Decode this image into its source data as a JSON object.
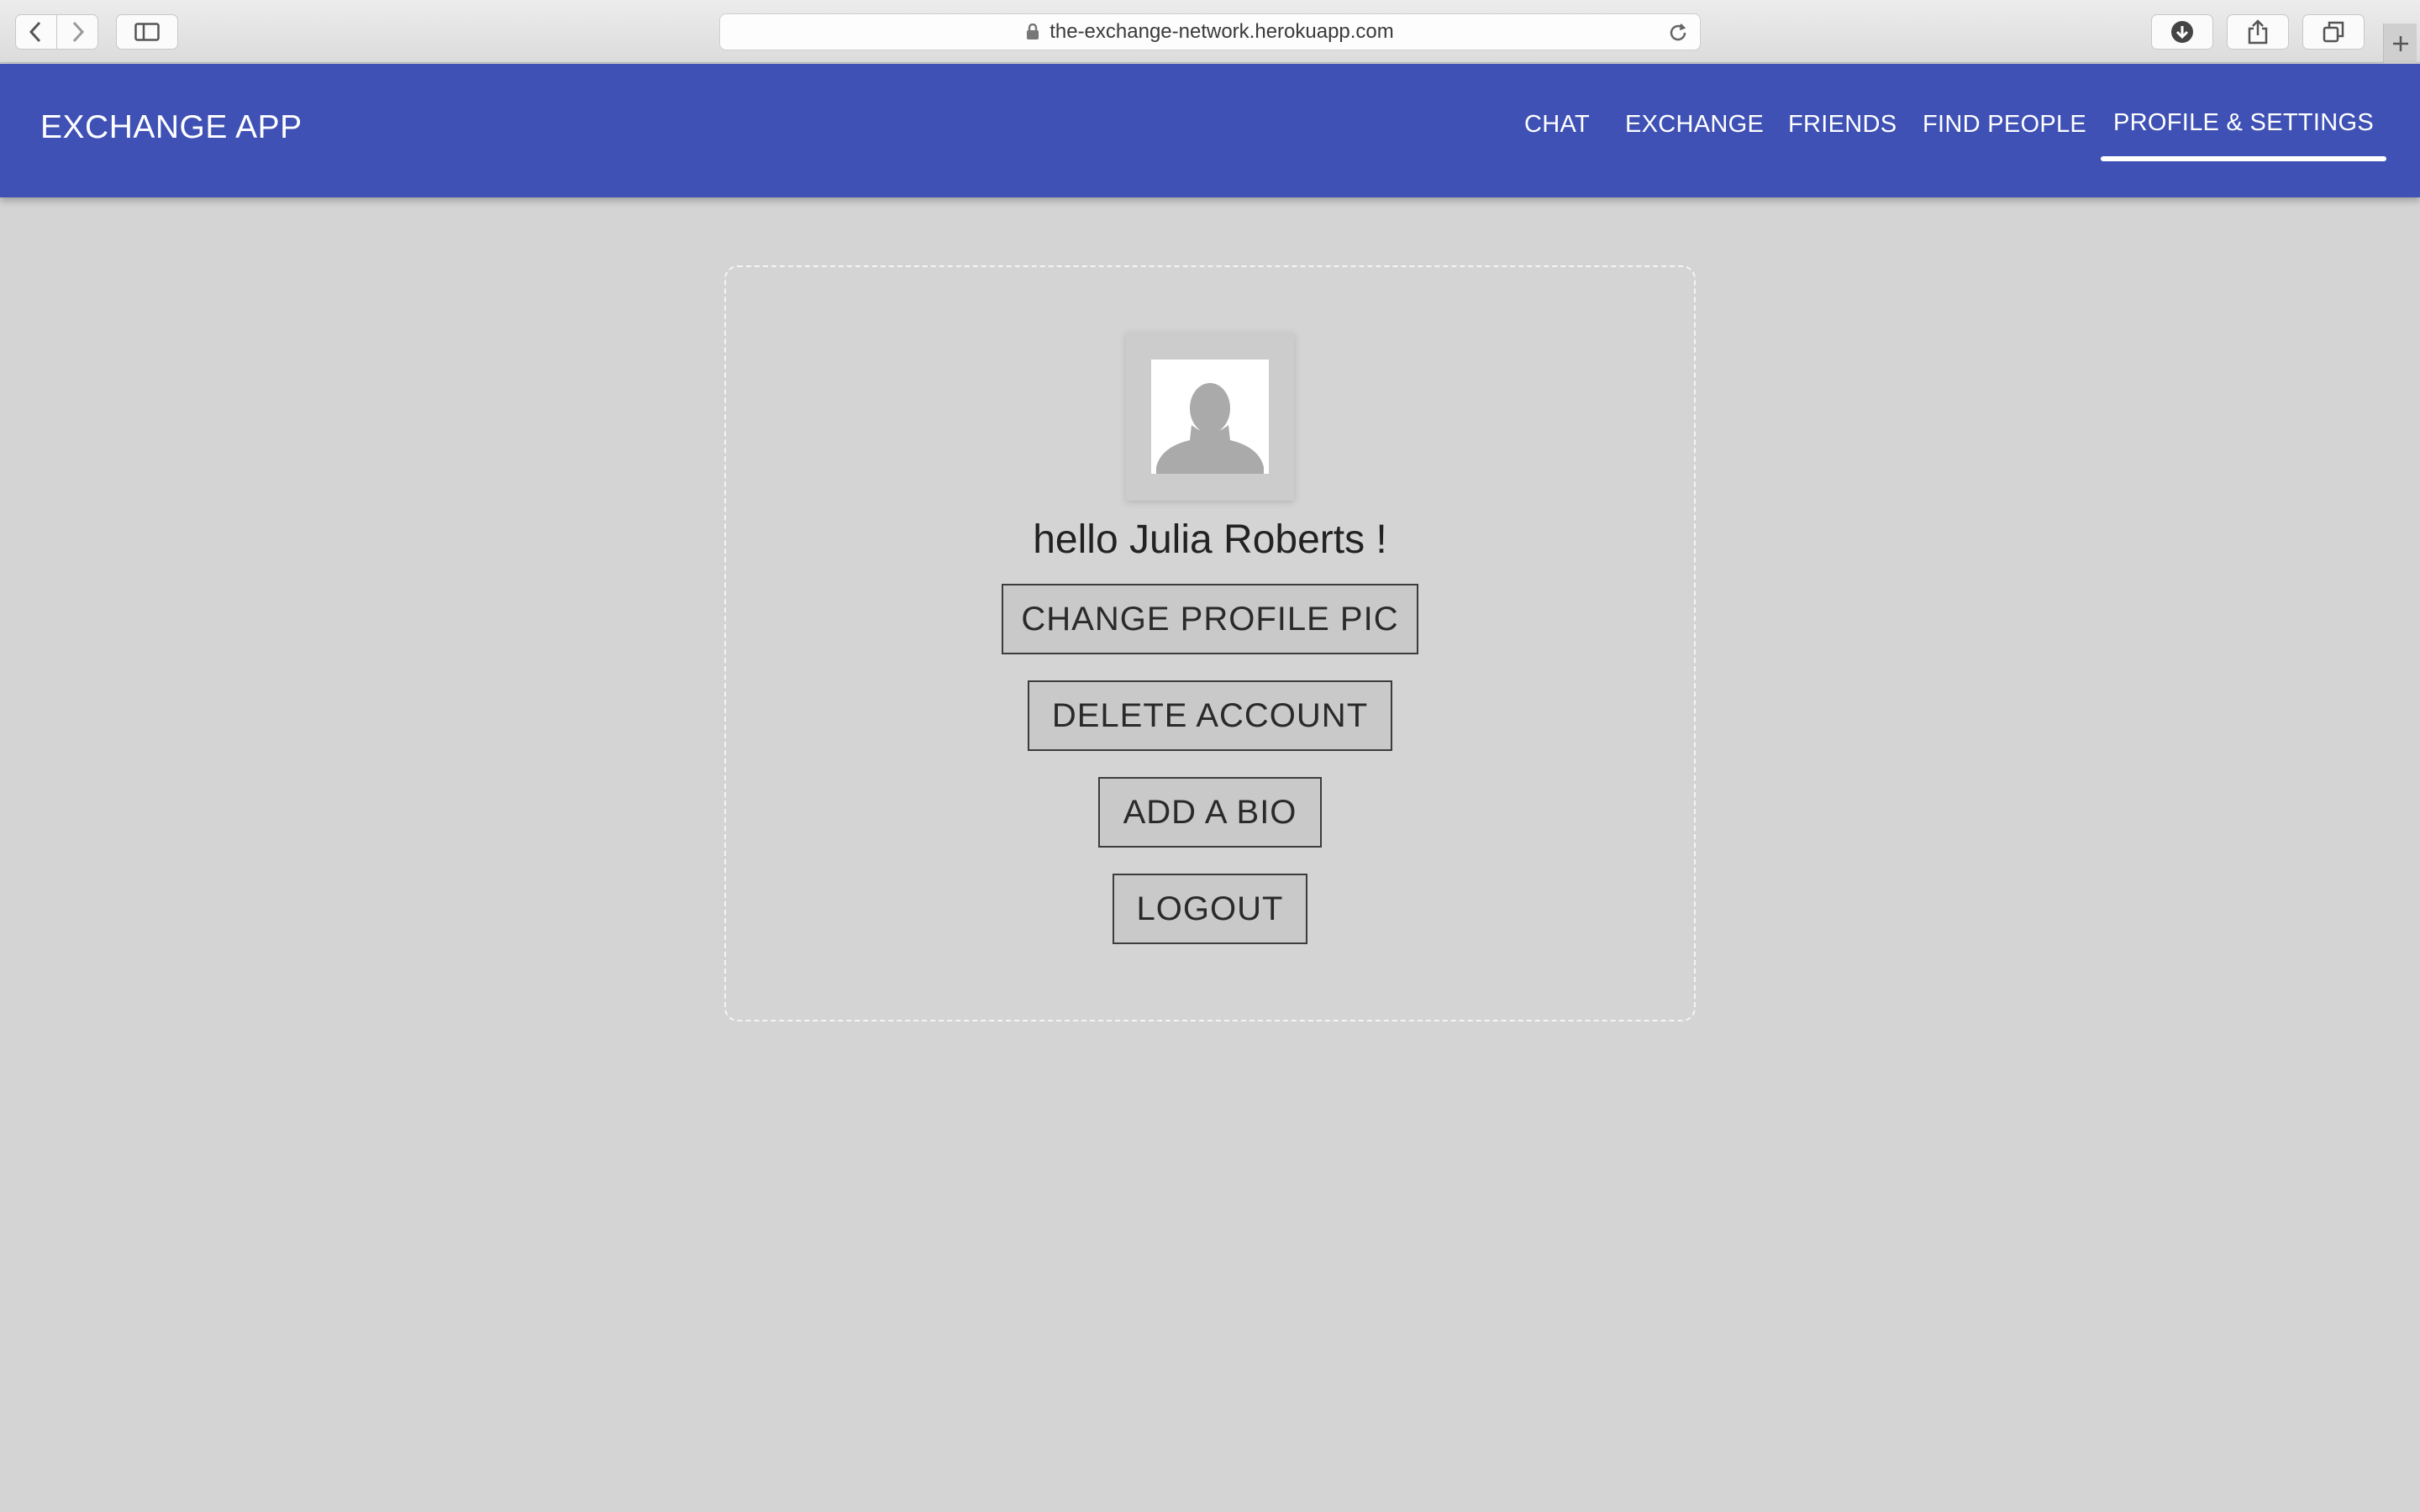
{
  "browser": {
    "url": "the-exchange-network.herokuapp.com"
  },
  "header": {
    "title": "EXCHANGE APP",
    "nav": [
      {
        "label": "CHAT"
      },
      {
        "label": "EXCHANGE"
      },
      {
        "label": "FRIENDS"
      },
      {
        "label": "FIND PEOPLE"
      },
      {
        "label": "PROFILE & SETTINGS",
        "active": true
      }
    ],
    "bg_color": "#3f51b5"
  },
  "profile": {
    "greeting": "hello Julia Roberts !",
    "avatar_icon": "default-user-silhouette",
    "buttons": {
      "change_pic": "CHANGE PROFILE PIC",
      "delete_account": "DELETE ACCOUNT",
      "add_bio": "ADD A BIO",
      "logout": "LOGOUT"
    }
  }
}
